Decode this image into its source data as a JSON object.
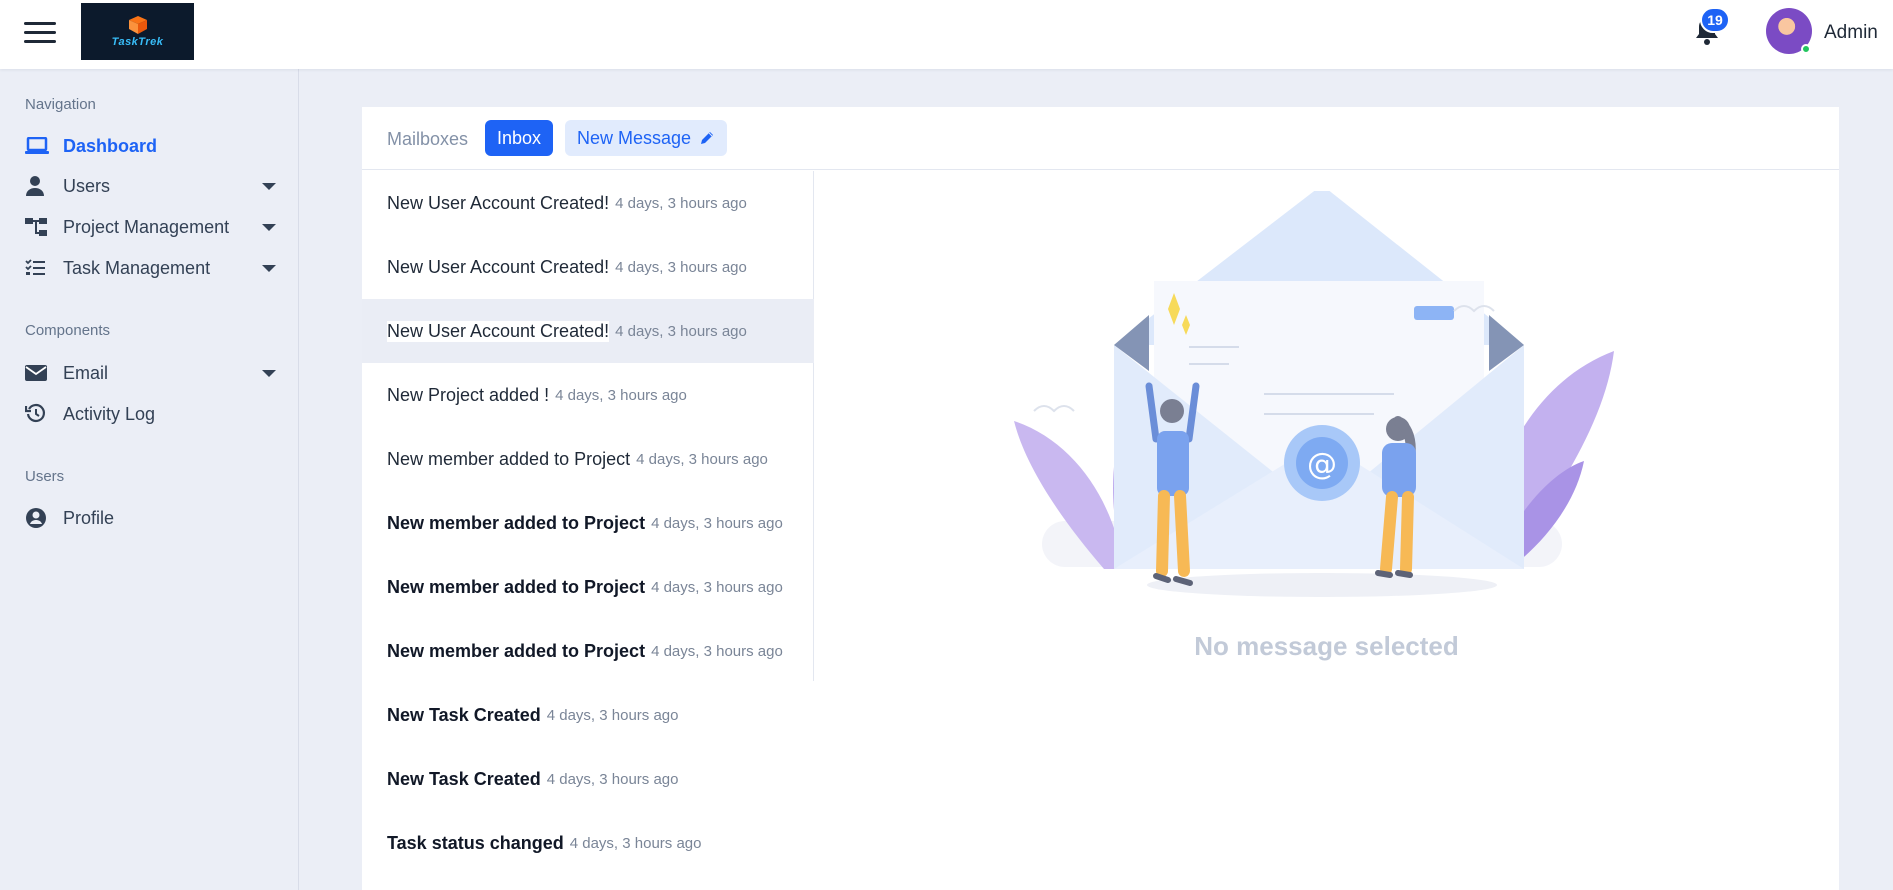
{
  "header": {
    "logo_text": "TaskTrek",
    "notification_count": "19",
    "user_name": "Admin"
  },
  "sidebar": {
    "sections": [
      {
        "heading": "Navigation"
      },
      {
        "heading": "Components"
      },
      {
        "heading": "Users"
      }
    ],
    "items": [
      {
        "label": "Dashboard",
        "icon": "laptop-icon",
        "active": true
      },
      {
        "label": "Users",
        "icon": "user-icon",
        "has_submenu": true
      },
      {
        "label": "Project Management",
        "icon": "sitemap-icon",
        "has_submenu": true
      },
      {
        "label": "Task Management",
        "icon": "task-list-icon",
        "has_submenu": true
      },
      {
        "label": "Email",
        "icon": "envelope-icon",
        "has_submenu": true
      },
      {
        "label": "Activity Log",
        "icon": "history-icon"
      },
      {
        "label": "Profile",
        "icon": "user-circle-icon"
      }
    ]
  },
  "toolbar": {
    "mailboxes_label": "Mailboxes",
    "inbox_label": "Inbox",
    "new_message_label": "New Message"
  },
  "messages": [
    {
      "subject": "New User Account Created!",
      "time": "4 days, 3 hours ago",
      "unread": false
    },
    {
      "subject": "New User Account Created!",
      "time": "4 days, 3 hours ago",
      "unread": false
    },
    {
      "subject": "New User Account Created!",
      "time": "4 days, 3 hours ago",
      "unread": false,
      "selected": true
    },
    {
      "subject": "New Project added !",
      "time": "4 days, 3 hours ago",
      "unread": false
    },
    {
      "subject": "New member added to Project",
      "time": "4 days, 3 hours ago",
      "unread": false
    },
    {
      "subject": "New member added to Project",
      "time": "4 days, 3 hours ago",
      "unread": true
    },
    {
      "subject": "New member added to Project",
      "time": "4 days, 3 hours ago",
      "unread": true
    },
    {
      "subject": "New member added to Project",
      "time": "4 days, 3 hours ago",
      "unread": true
    },
    {
      "subject": "New Task Created",
      "time": "4 days, 3 hours ago",
      "unread": true
    },
    {
      "subject": "New Task Created",
      "time": "4 days, 3 hours ago",
      "unread": true
    },
    {
      "subject": "Task status changed",
      "time": "4 days, 3 hours ago",
      "unread": true
    }
  ],
  "preview": {
    "empty_text": "No message selected"
  },
  "colors": {
    "accent": "#1e63f5",
    "sidebar_bg": "#ebeef6",
    "muted_text": "#7a8597"
  }
}
